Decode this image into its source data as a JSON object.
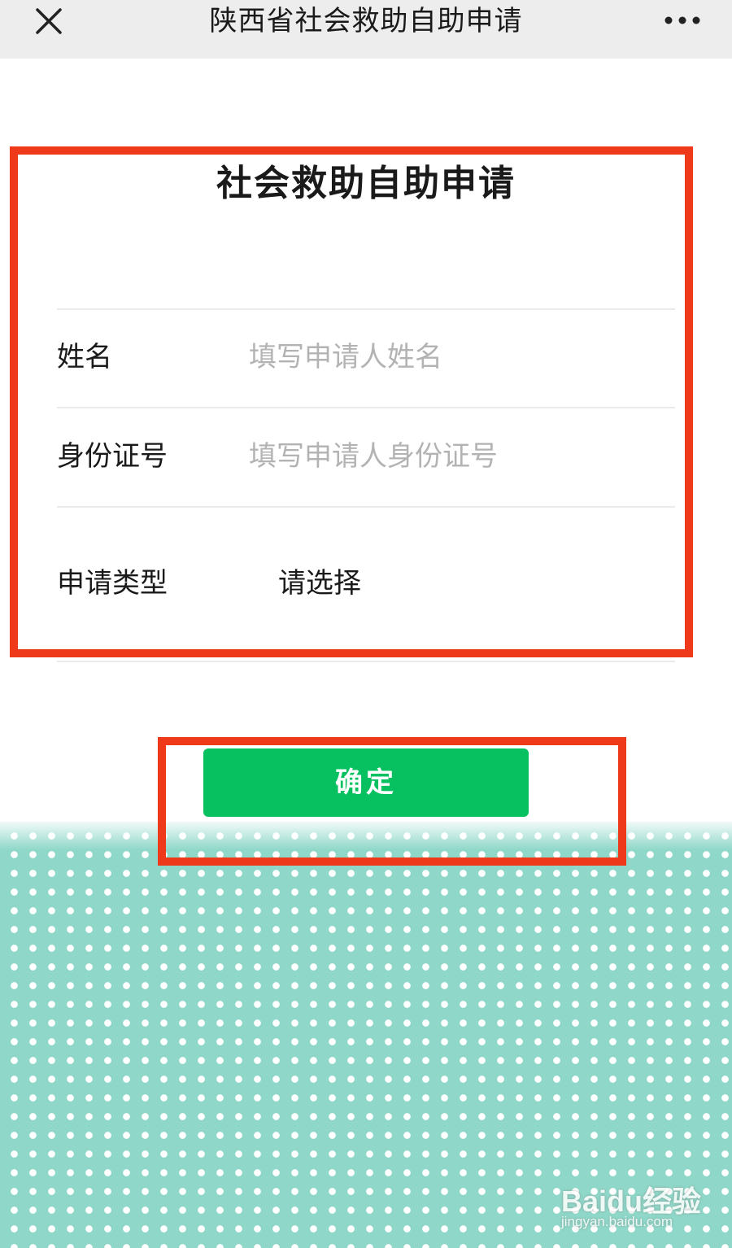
{
  "navbar": {
    "title": "陕西省社会救助自助申请",
    "close_icon": "close-icon",
    "more_icon": "more-icon"
  },
  "form": {
    "title": "社会救助自助申请",
    "fields": [
      {
        "label": "姓名",
        "placeholder": "填写申请人姓名",
        "value": ""
      },
      {
        "label": "身份证号",
        "placeholder": "填写申请人身份证号",
        "value": ""
      }
    ],
    "apply_type": {
      "label": "申请类型",
      "value": "请选择"
    }
  },
  "confirm_label": "确定",
  "watermark": {
    "brand": "Baidu经验",
    "site": "jingyan.baidu.com"
  },
  "colors": {
    "primary_button": "#07c160",
    "highlight_border": "#ee3a1a",
    "background_pattern": "#8fd8c9"
  }
}
